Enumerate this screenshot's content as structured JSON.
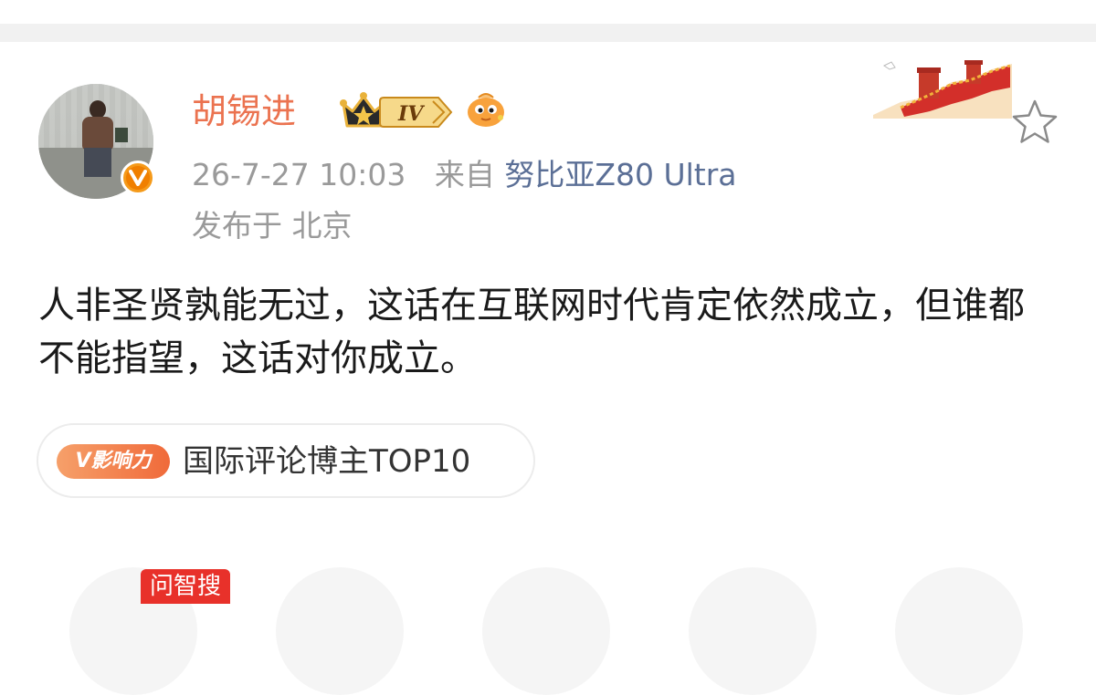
{
  "header": {
    "background": "#f1f1f1"
  },
  "user": {
    "name": "胡锡进",
    "level": "IV",
    "name_color": "#eb7350",
    "badges": [
      "vip-crown-icon",
      "level-iv-badge",
      "fish-emoji-icon"
    ]
  },
  "post": {
    "timestamp": "26-7-27 10:03",
    "source_prefix": "来自",
    "source_device": "努比亚Z80 Ultra",
    "location": "发布于 北京",
    "text": "人非圣贤孰能无过，这话在互联网时代肯定依然成立，但谁都不能指望，这话对你成立。"
  },
  "influence": {
    "badge_label": "V影响力",
    "text": "国际评论博主TOP10"
  },
  "bottom": {
    "tag_label": "问智搜"
  },
  "colors": {
    "accent": "#eb7350",
    "link": "#5b6f96",
    "meta": "#9a9a9a",
    "verified": "#f59a1a",
    "tag_red": "#e8312a"
  },
  "icons": {
    "verified": "verified-v-icon",
    "favorite": "star-icon",
    "decoration": "great-wall-decoration"
  }
}
